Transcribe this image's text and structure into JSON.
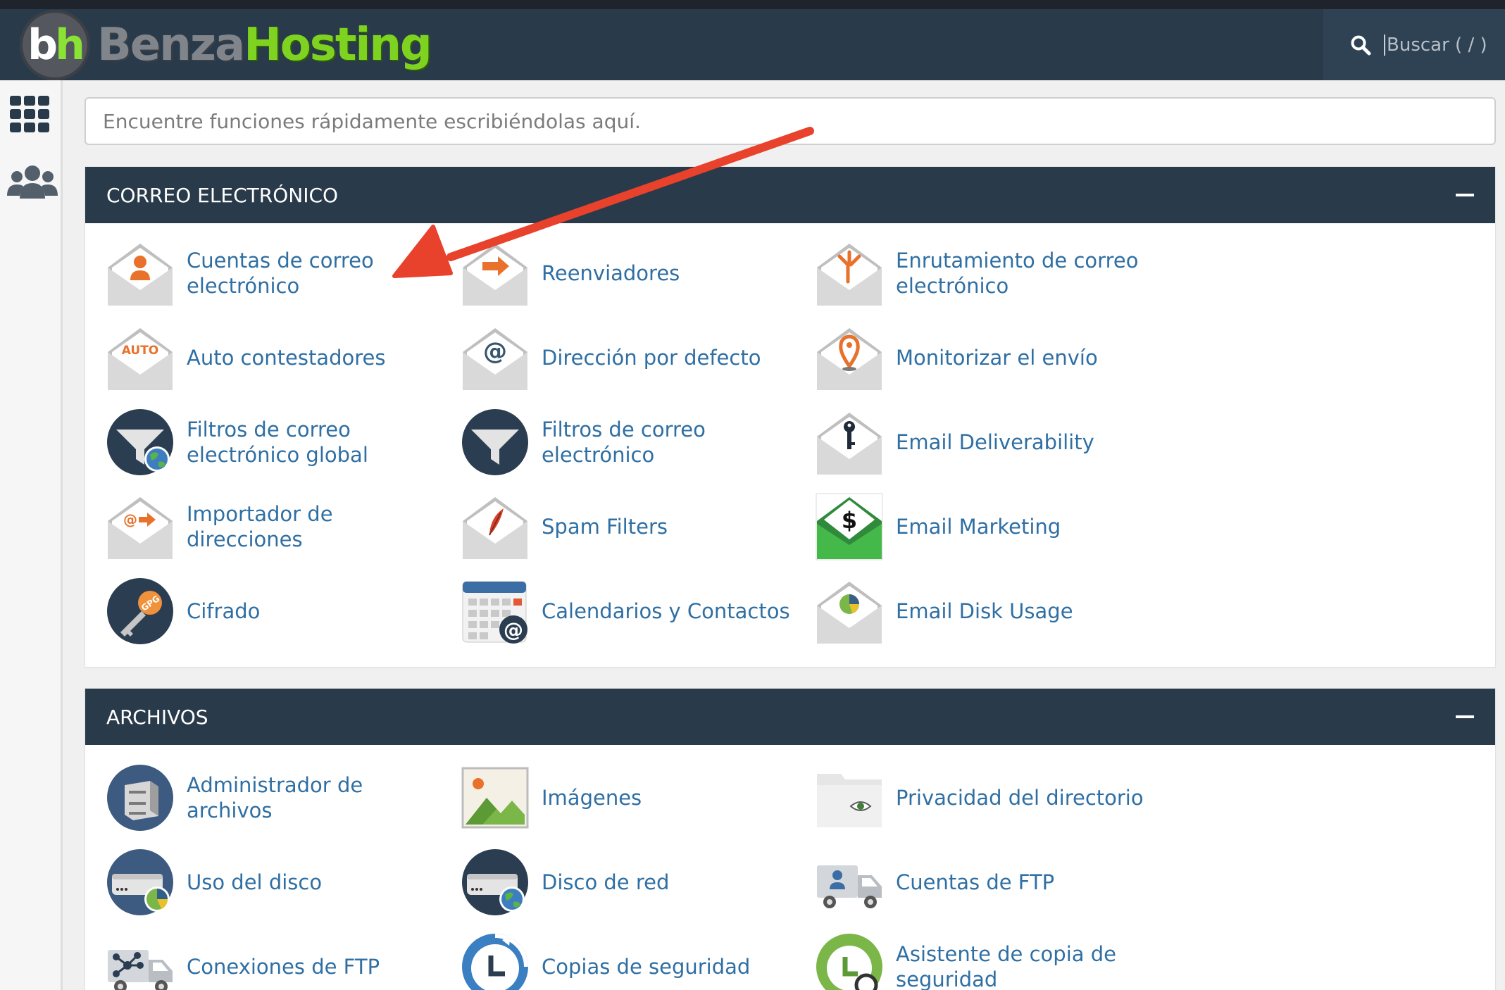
{
  "brand": {
    "initial_b": "b",
    "initial_h": "h",
    "word1": "Benza",
    "word2": "Hosting"
  },
  "header": {
    "search_placeholder": "Buscar ( / )"
  },
  "sidebar": {
    "items": [
      {
        "icon": "grid-apps-icon"
      },
      {
        "icon": "users-icon"
      }
    ]
  },
  "quick_search": {
    "placeholder": "Encuentre funciones rápidamente escribiéndolas aquí."
  },
  "sections": [
    {
      "title": "CORREO ELECTRÓNICO",
      "items": [
        {
          "label": "Cuentas de correo electrónico",
          "icon": "email-account-icon"
        },
        {
          "label": "Reenviadores",
          "icon": "email-forwarder-icon"
        },
        {
          "label": "Enrutamiento de correo electrónico",
          "icon": "email-routing-icon"
        },
        {
          "label": "Auto contestadores",
          "icon": "autoresponder-icon",
          "badge": "AUTO"
        },
        {
          "label": "Dirección por defecto",
          "icon": "default-address-icon",
          "badge": "@"
        },
        {
          "label": "Monitorizar el envío",
          "icon": "track-delivery-icon"
        },
        {
          "label": "Filtros de correo electrónico global",
          "icon": "global-filter-icon"
        },
        {
          "label": "Filtros de correo electrónico",
          "icon": "email-filter-icon"
        },
        {
          "label": "Email Deliverability",
          "icon": "deliverability-key-icon"
        },
        {
          "label": "Importador de direcciones",
          "icon": "address-importer-icon",
          "badge": "@"
        },
        {
          "label": "Spam Filters",
          "icon": "spam-filter-icon"
        },
        {
          "label": "Email Marketing",
          "icon": "email-marketing-icon",
          "badge": "$"
        },
        {
          "label": "Cifrado",
          "icon": "encryption-key-icon",
          "badge": "GPG"
        },
        {
          "label": "Calendarios y Contactos",
          "icon": "calendar-contacts-icon",
          "badge": "@"
        },
        {
          "label": "Email Disk Usage",
          "icon": "email-disk-usage-icon"
        }
      ]
    },
    {
      "title": "ARCHIVOS",
      "items": [
        {
          "label": "Administrador de archivos",
          "icon": "file-manager-icon"
        },
        {
          "label": "Imágenes",
          "icon": "images-icon"
        },
        {
          "label": "Privacidad del directorio",
          "icon": "directory-privacy-icon"
        },
        {
          "label": "Uso del disco",
          "icon": "disk-usage-icon"
        },
        {
          "label": "Disco de red",
          "icon": "web-disk-icon"
        },
        {
          "label": "Cuentas de FTP",
          "icon": "ftp-accounts-icon"
        },
        {
          "label": "Conexiones de FTP",
          "icon": "ftp-connections-icon"
        },
        {
          "label": "Copias de seguridad",
          "icon": "backup-icon"
        },
        {
          "label": "Asistente de copia de seguridad",
          "icon": "backup-wizard-icon"
        }
      ]
    }
  ],
  "colors": {
    "header": "#293a4a",
    "link": "#2f6fa3",
    "accent_orange": "#e8712b",
    "annotation_arrow": "#e8412c"
  }
}
